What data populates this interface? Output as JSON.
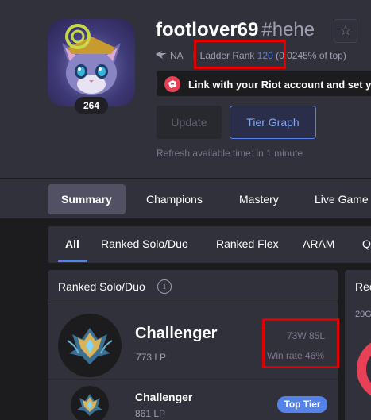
{
  "profile": {
    "level": "264",
    "name": "footlover69",
    "tag": "#hehe",
    "region": "NA",
    "ladder_label": "Ladder Rank",
    "ladder_rank": "120",
    "ladder_pct": "(0.0245% of top)",
    "riot_link_text": "Link with your Riot account and set your",
    "update_label": "Update",
    "tier_graph_label": "Tier Graph",
    "refresh_text": "Refresh available time: in 1 minute"
  },
  "nav": {
    "items": [
      "Summary",
      "Champions",
      "Mastery",
      "Live Game"
    ]
  },
  "queues": {
    "items": [
      "All",
      "Ranked Solo/Duo",
      "Ranked Flex",
      "ARAM",
      "Q"
    ]
  },
  "ranked": {
    "title": "Ranked Solo/Duo",
    "info_glyph": "i",
    "current": {
      "tier": "Challenger",
      "lp": "773 LP",
      "record": "73W 85L",
      "winrate": "Win rate 46%"
    },
    "peak": {
      "tier": "Challenger",
      "lp": "861 LP",
      "badge": "Top Tier"
    }
  },
  "side_card": {
    "title": "Rec",
    "sub": "20G"
  },
  "colors": {
    "accent": "#5383e8",
    "loss": "#e84057",
    "highlight_box": "#e00000"
  },
  "icons": {
    "favorite": "star-icon",
    "region": "wing-icon",
    "riot": "riot-fist-icon",
    "info": "info-icon"
  }
}
